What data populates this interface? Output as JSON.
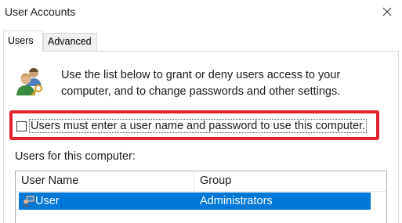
{
  "window": {
    "title": "User Accounts",
    "close_icon": "close-icon"
  },
  "tabs": [
    {
      "label": "Users",
      "active": true
    },
    {
      "label": "Advanced",
      "active": false
    }
  ],
  "users_tab": {
    "header_icon": "users-group-icon",
    "description": "Use the list below to grant or deny users access to your computer, and to change passwords and other settings.",
    "require_login_checkbox": {
      "label": "Users must enter a user name and password to use this computer.",
      "checked": false
    },
    "highlight_color": "#e2222b",
    "users_list_label": "Users for this computer:",
    "columns": [
      "User Name",
      "Group"
    ],
    "rows": [
      {
        "icon": "user-account-icon",
        "name": "User",
        "group": "Administrators",
        "selected": true
      }
    ],
    "selection_color": "#0078d7"
  }
}
